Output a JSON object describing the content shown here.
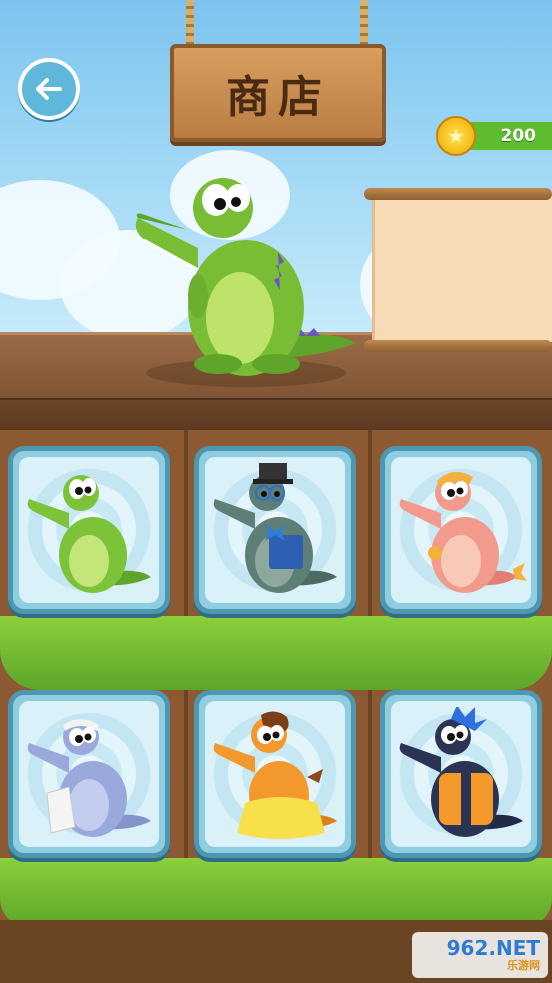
{
  "header": {
    "title": "商店",
    "back_icon": "back-arrow-icon"
  },
  "wallet": {
    "coins": "200",
    "coin_icon": "star-coin-icon"
  },
  "preview": {
    "character": "green-crocodile",
    "info_panel": ""
  },
  "shop": {
    "items": [
      {
        "id": "green",
        "color": "#7cc33a"
      },
      {
        "id": "gray-hat-glasses",
        "color": "#5e7f76"
      },
      {
        "id": "pink-bandana",
        "color": "#f29b8c"
      },
      {
        "id": "lavender-towel",
        "color": "#9aa8dc"
      },
      {
        "id": "orange-dress",
        "color": "#f3982c"
      },
      {
        "id": "navy-punk-vest",
        "color": "#2c3456"
      }
    ]
  },
  "watermark": {
    "main": "962.NET",
    "sub": "乐游网"
  }
}
